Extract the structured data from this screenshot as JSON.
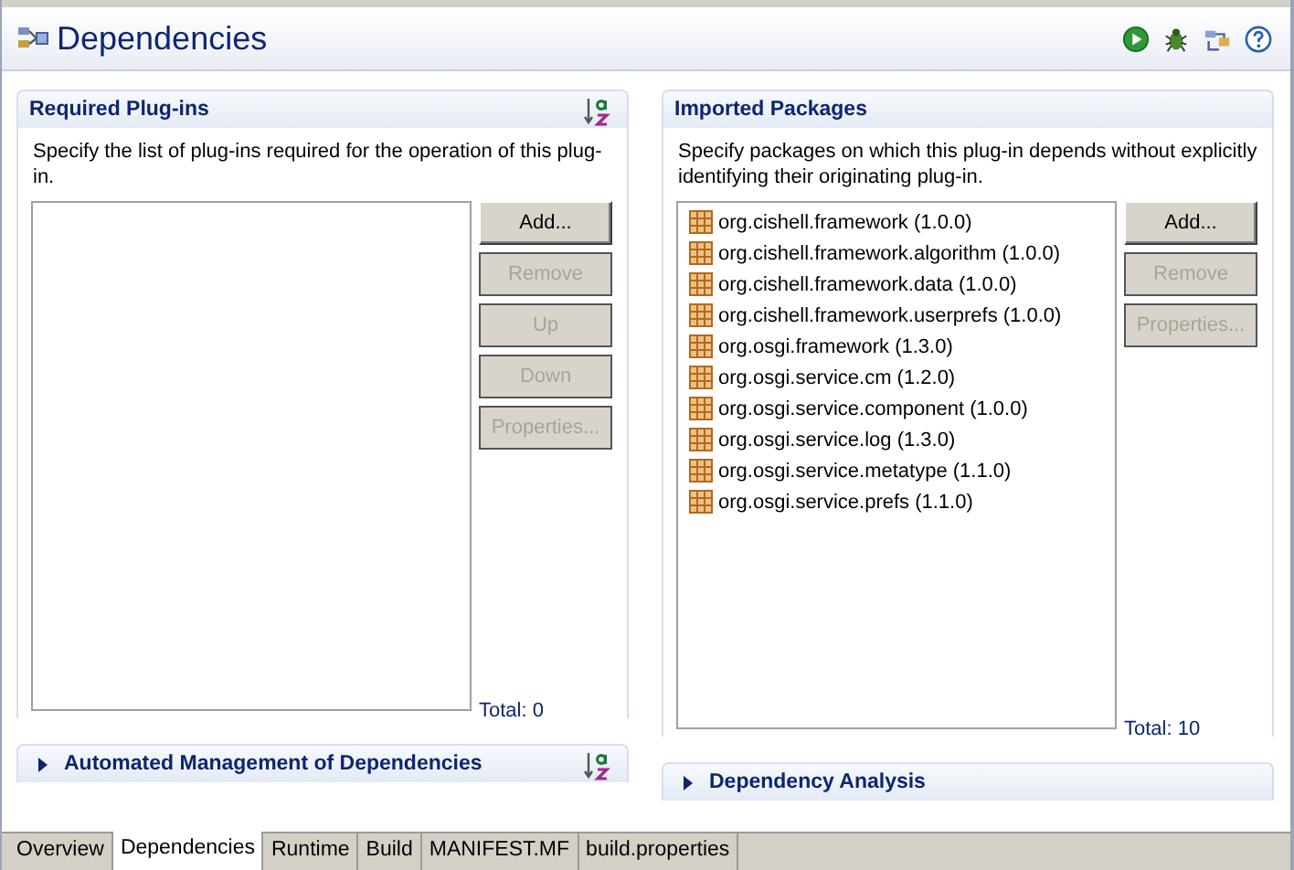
{
  "editor": {
    "title": "Dependencies"
  },
  "columns": [
    [
      {
        "title": "Required Plug-ins",
        "expanded": true,
        "sortable": true,
        "description": "Specify the list of plug-ins required for the operation of this plug-in.",
        "buttons": [
          {
            "label": "Add...",
            "disabled": false
          },
          {
            "label": "Remove",
            "disabled": true
          },
          {
            "label": "Up",
            "disabled": true
          },
          {
            "label": "Down",
            "disabled": true
          },
          {
            "label": "Properties...",
            "disabled": true
          }
        ],
        "total": "Total: 0"
      },
      {
        "title": "Automated Management of Dependencies",
        "expanded": false,
        "sortable": true
      }
    ],
    [
      {
        "title": "Imported Packages",
        "expanded": true,
        "sortable": false,
        "description": "Specify packages on which this plug-in depends without explicitly identifying their originating plug-in.",
        "items": [
          "org.cishell.framework (1.0.0)",
          "org.cishell.framework.algorithm (1.0.0)",
          "org.cishell.framework.data (1.0.0)",
          "org.cishell.framework.userprefs (1.0.0)",
          "org.osgi.framework (1.3.0)",
          "org.osgi.service.cm (1.2.0)",
          "org.osgi.service.component (1.0.0)",
          "org.osgi.service.log (1.3.0)",
          "org.osgi.service.metatype (1.1.0)",
          "org.osgi.service.prefs (1.1.0)"
        ],
        "buttons": [
          {
            "label": "Add...",
            "disabled": false
          },
          {
            "label": "Remove",
            "disabled": true
          },
          {
            "label": "Properties...",
            "disabled": true
          }
        ],
        "total": "Total: 10"
      },
      {
        "title": "Dependency Analysis",
        "expanded": false,
        "sortable": false
      }
    ]
  ],
  "tabs": [
    {
      "label": "Overview",
      "selected": false
    },
    {
      "label": "Dependencies",
      "selected": true
    },
    {
      "label": "Runtime",
      "selected": false
    },
    {
      "label": "Build",
      "selected": false
    },
    {
      "label": "MANIFEST.MF",
      "selected": false
    },
    {
      "label": "build.properties",
      "selected": false
    }
  ]
}
